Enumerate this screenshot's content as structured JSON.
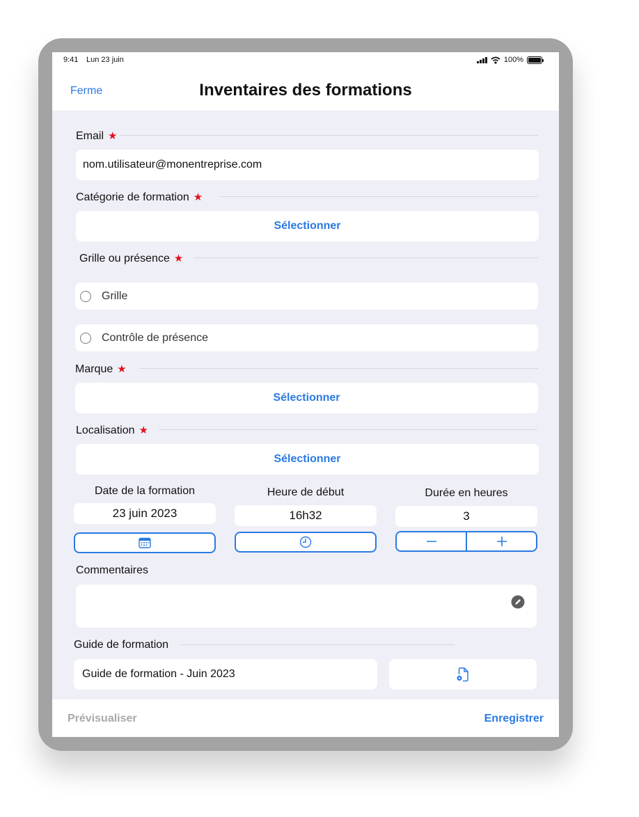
{
  "status_bar": {
    "time": "9:41",
    "date": "Lun 23 juin",
    "battery": "100%"
  },
  "nav": {
    "left_button": "Ferme",
    "title": "Inventaires des formations"
  },
  "form": {
    "email": {
      "label": "Email",
      "value": "nom.utilisateur@monentreprise.com"
    },
    "categorie": {
      "label": "Catégorie de formation",
      "button": "Sélectionner"
    },
    "grille_presence": {
      "label": "Grille ou présence",
      "options": [
        "Grille",
        "Contrôle de présence"
      ]
    },
    "marque": {
      "label": "Marque",
      "button": "Sélectionner"
    },
    "localisation": {
      "label": "Localisation",
      "button": "Sélectionner"
    },
    "date": {
      "label": "Date de la formation",
      "value": "23 juin 2023"
    },
    "heure": {
      "label": "Heure de début",
      "value": "16h32"
    },
    "duree": {
      "label": "Durée en heures",
      "value": "3"
    },
    "commentaires": {
      "label": "Commentaires",
      "value": ""
    },
    "guide": {
      "label": "Guide de formation",
      "value": "Guide de formation - Juin 2023"
    }
  },
  "bottom_bar": {
    "left": "Prévisualiser",
    "right": "Enregistrer"
  },
  "icons": {
    "required": "star-icon",
    "date_picker": "calendar-icon",
    "time_picker": "clock-icon",
    "decrement": "minus-icon",
    "increment": "plus-icon",
    "edit": "pencil-icon",
    "file": "file-settings-icon"
  },
  "colors": {
    "accent": "#2a7ae2",
    "required": "#e3101b",
    "background": "#efeff7"
  }
}
